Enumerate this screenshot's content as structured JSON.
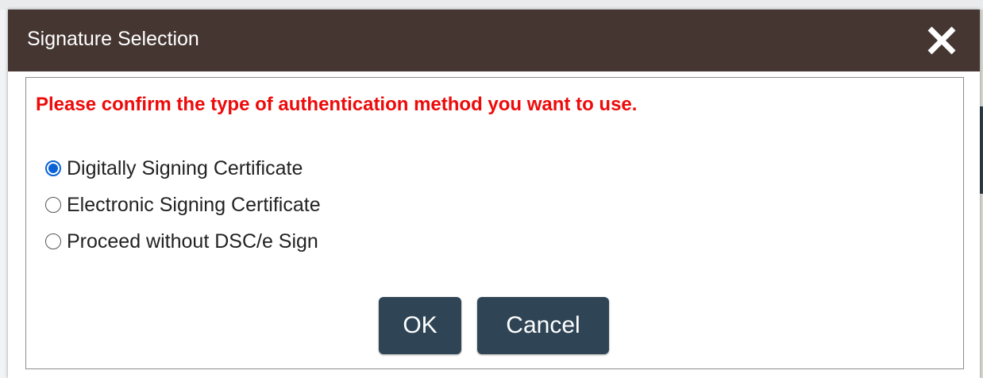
{
  "dialog": {
    "title": "Signature Selection",
    "close_icon": "close-icon",
    "prompt": "Please confirm the type of authentication method you want to use.",
    "options": [
      {
        "label": "Digitally Signing Certificate",
        "selected": true
      },
      {
        "label": "Electronic Signing Certificate",
        "selected": false
      },
      {
        "label": "Proceed without DSC/e Sign",
        "selected": false
      }
    ],
    "ok_label": "OK",
    "cancel_label": "Cancel"
  },
  "colors": {
    "titlebar": "#453632",
    "prompt_text": "#ee0a0a",
    "button": "#2f4556",
    "radio_selected": "#0a63d6"
  }
}
